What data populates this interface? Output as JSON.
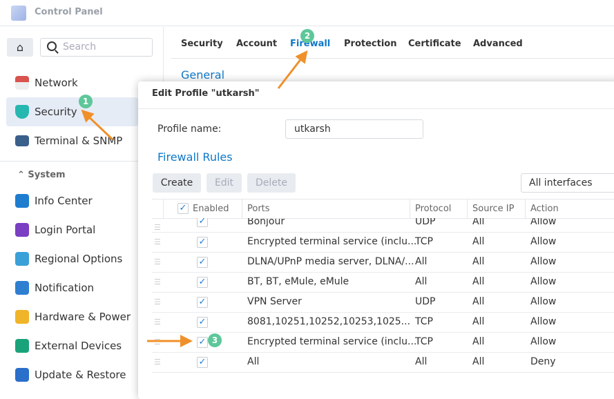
{
  "window": {
    "title": "Control Panel"
  },
  "sidebar": {
    "search_placeholder": "Search",
    "items": [
      {
        "label": "Network"
      },
      {
        "label": "Security"
      },
      {
        "label": "Terminal & SNMP"
      }
    ],
    "system_header": "System",
    "system_items": [
      {
        "label": "Info Center"
      },
      {
        "label": "Login Portal"
      },
      {
        "label": "Regional Options"
      },
      {
        "label": "Notification"
      },
      {
        "label": "Hardware & Power"
      },
      {
        "label": "External Devices"
      },
      {
        "label": "Update & Restore"
      }
    ]
  },
  "tabs": [
    {
      "label": "Security"
    },
    {
      "label": "Account"
    },
    {
      "label": "Firewall"
    },
    {
      "label": "Protection"
    },
    {
      "label": "Certificate"
    },
    {
      "label": "Advanced"
    }
  ],
  "section_title": "General",
  "dialog": {
    "title": "Edit Profile \"utkarsh\"",
    "profile_label": "Profile name:",
    "profile_value": "utkarsh",
    "rules_title": "Firewall Rules",
    "buttons": {
      "create": "Create",
      "edit": "Edit",
      "delete": "Delete"
    },
    "interface_select": "All interfaces",
    "columns": {
      "enabled": "Enabled",
      "ports": "Ports",
      "protocol": "Protocol",
      "source_ip": "Source IP",
      "action": "Action"
    },
    "rows": [
      {
        "enabled": true,
        "ports": "Bonjour",
        "protocol": "UDP",
        "source_ip": "All",
        "action": "Allow"
      },
      {
        "enabled": true,
        "ports": "Encrypted terminal service (inclu...",
        "protocol": "TCP",
        "source_ip": "All",
        "action": "Allow"
      },
      {
        "enabled": true,
        "ports": "DLNA/UPnP media server, DLNA/...",
        "protocol": "All",
        "source_ip": "All",
        "action": "Allow"
      },
      {
        "enabled": true,
        "ports": "BT, BT, eMule, eMule",
        "protocol": "All",
        "source_ip": "All",
        "action": "Allow"
      },
      {
        "enabled": true,
        "ports": "VPN Server",
        "protocol": "UDP",
        "source_ip": "All",
        "action": "Allow"
      },
      {
        "enabled": true,
        "ports": "8081,10251,10252,10253,1025...",
        "protocol": "TCP",
        "source_ip": "All",
        "action": "Allow"
      },
      {
        "enabled": true,
        "ports": "Encrypted terminal service (inclu...",
        "protocol": "TCP",
        "source_ip": "All",
        "action": "Allow"
      },
      {
        "enabled": true,
        "ports": "All",
        "protocol": "All",
        "source_ip": "All",
        "action": "Deny"
      }
    ]
  },
  "annotations": [
    "1",
    "2",
    "3"
  ],
  "colors": {
    "accent": "#0e78c8",
    "annotation_arrow": "#f0902a",
    "annotation_badge": "#5ec79a"
  }
}
